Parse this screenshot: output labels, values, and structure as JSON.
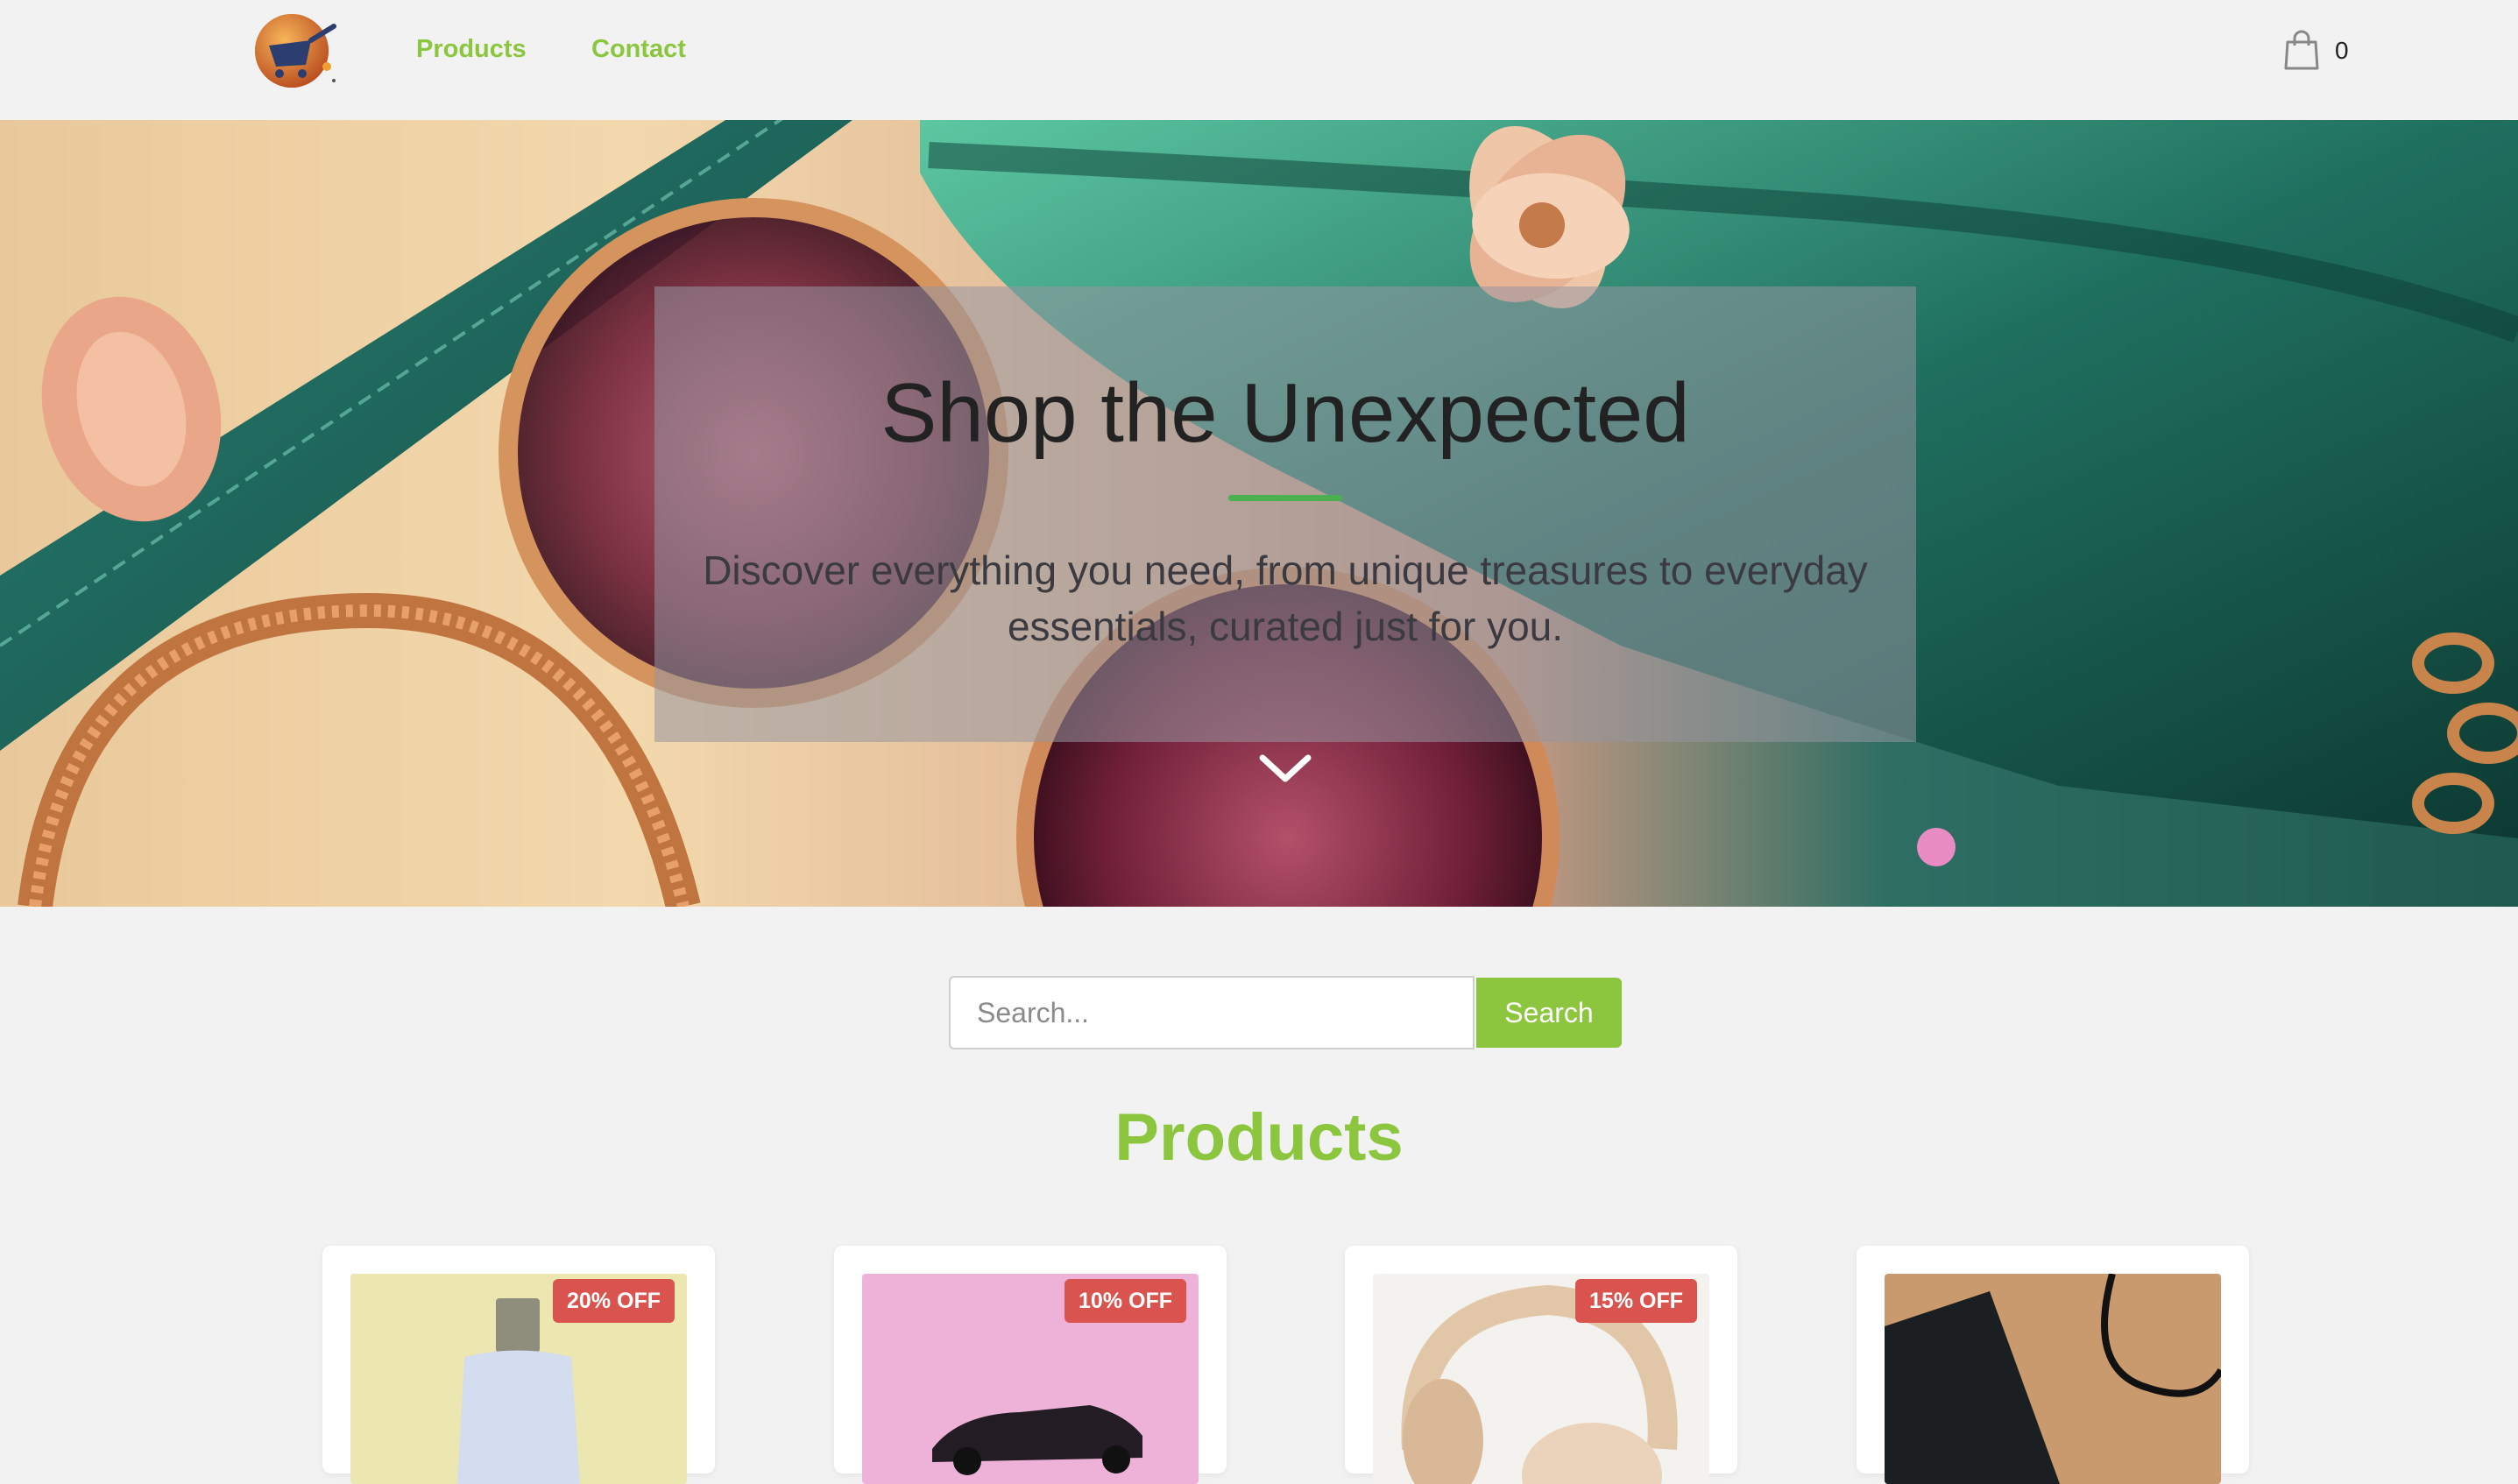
{
  "nav": {
    "links": [
      "Products",
      "Contact"
    ],
    "cart_count": "0"
  },
  "hero": {
    "title": "Shop the Unexpected",
    "subtitle_line1": "Discover everything you need, from unique treasures to everyday",
    "subtitle_line2": "essentials, curated just for you."
  },
  "search": {
    "placeholder": "Search...",
    "button_label": "Search"
  },
  "products": {
    "title": "Products",
    "items": [
      {
        "image": "perfume bottle",
        "discount": "20% OFF"
      },
      {
        "image": "toy car",
        "discount": "10% OFF"
      },
      {
        "image": "headphones",
        "discount": "15% OFF"
      },
      {
        "image": "phone and cable",
        "discount": ""
      }
    ]
  },
  "colors": {
    "accent_green": "#8cc63f",
    "badge_red": "#d9534f"
  }
}
